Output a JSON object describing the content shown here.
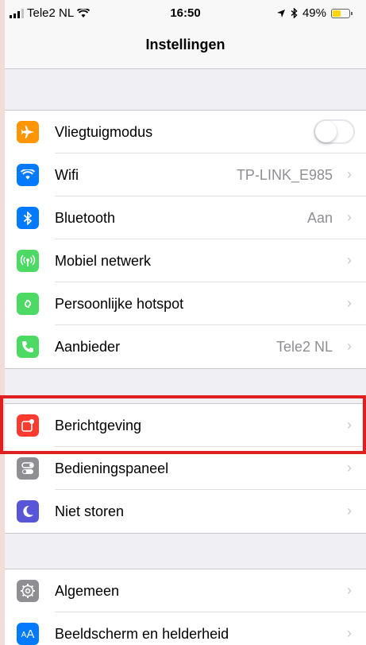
{
  "status_bar": {
    "carrier": "Tele2 NL",
    "time": "16:50",
    "battery_percent": "49%",
    "battery_level": 0.49,
    "icons": [
      "signal-icon",
      "wifi-icon",
      "location-icon",
      "bluetooth-icon",
      "battery-icon"
    ]
  },
  "nav": {
    "title": "Instellingen"
  },
  "groups": [
    {
      "rows": [
        {
          "label": "Vliegtuigmodus",
          "icon": "airplane-icon",
          "color": "#ff9500",
          "toggle": false
        },
        {
          "label": "Wifi",
          "icon": "wifi-icon",
          "color": "#007aff",
          "value": "TP-LINK_E985"
        },
        {
          "label": "Bluetooth",
          "icon": "bluetooth-icon",
          "color": "#007aff",
          "value": "Aan"
        },
        {
          "label": "Mobiel netwerk",
          "icon": "antenna-icon",
          "color": "#4cd964"
        },
        {
          "label": "Persoonlijke hotspot",
          "icon": "hotspot-icon",
          "color": "#4cd964"
        },
        {
          "label": "Aanbieder",
          "icon": "phone-icon",
          "color": "#4cd964",
          "value": "Tele2 NL"
        }
      ]
    },
    {
      "rows": [
        {
          "label": "Berichtgeving",
          "icon": "notifications-icon",
          "color": "#ff3b30",
          "highlighted": true
        },
        {
          "label": "Bedieningspaneel",
          "icon": "control-center-icon",
          "color": "#8e8e93"
        },
        {
          "label": "Niet storen",
          "icon": "moon-icon",
          "color": "#5856d6"
        }
      ]
    },
    {
      "rows": [
        {
          "label": "Algemeen",
          "icon": "gear-icon",
          "color": "#8e8e93"
        },
        {
          "label": "Beeldscherm en helderheid",
          "icon": "display-icon",
          "color": "#007aff"
        }
      ]
    }
  ],
  "colors": {
    "highlight_border": "#e02020",
    "background": "#efeff4"
  }
}
